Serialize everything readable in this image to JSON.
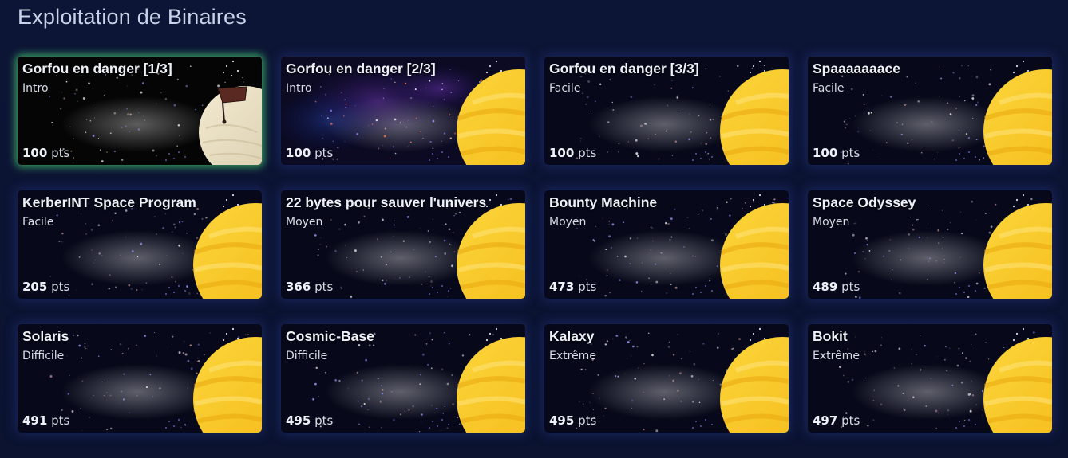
{
  "section": {
    "title": "Exploitation de Binaires"
  },
  "points_unit": "pts",
  "challenges": [
    {
      "name": "Gorfou en danger [1/3]",
      "difficulty": "Intro",
      "points": "100",
      "solved": true,
      "art": "moon",
      "sky": "dark"
    },
    {
      "name": "Gorfou en danger [2/3]",
      "difficulty": "Intro",
      "points": "100",
      "solved": false,
      "art": "planet",
      "sky": "nebula"
    },
    {
      "name": "Gorfou en danger [3/3]",
      "difficulty": "Facile",
      "points": "100",
      "solved": false,
      "art": "planet",
      "sky": "dark"
    },
    {
      "name": "Spaaaaaaace",
      "difficulty": "Facile",
      "points": "100",
      "solved": false,
      "art": "planet",
      "sky": "dark"
    },
    {
      "name": "KerberINT Space Program",
      "difficulty": "Facile",
      "points": "205",
      "solved": false,
      "art": "planet",
      "sky": "dark"
    },
    {
      "name": "22 bytes pour sauver l'univers",
      "difficulty": "Moyen",
      "points": "366",
      "solved": false,
      "art": "planet",
      "sky": "dark"
    },
    {
      "name": "Bounty Machine",
      "difficulty": "Moyen",
      "points": "473",
      "solved": false,
      "art": "planet",
      "sky": "dark"
    },
    {
      "name": "Space Odyssey",
      "difficulty": "Moyen",
      "points": "489",
      "solved": false,
      "art": "planet",
      "sky": "dark"
    },
    {
      "name": "Solaris",
      "difficulty": "Difficile",
      "points": "491",
      "solved": false,
      "art": "planet",
      "sky": "dark"
    },
    {
      "name": "Cosmic-Base",
      "difficulty": "Difficile",
      "points": "495",
      "solved": false,
      "art": "planet",
      "sky": "dark"
    },
    {
      "name": "Kalaxy",
      "difficulty": "Extrême",
      "points": "495",
      "solved": false,
      "art": "planet",
      "sky": "dark"
    },
    {
      "name": "Bokit",
      "difficulty": "Extrême",
      "points": "497",
      "solved": false,
      "art": "planet",
      "sky": "dark"
    }
  ],
  "colors": {
    "background": "#0c1433",
    "solved_glow": "#46c86e",
    "planet_yellow": "#f9c92a",
    "moon_cream": "#e8dfc4",
    "flag": "#5a2a22"
  }
}
